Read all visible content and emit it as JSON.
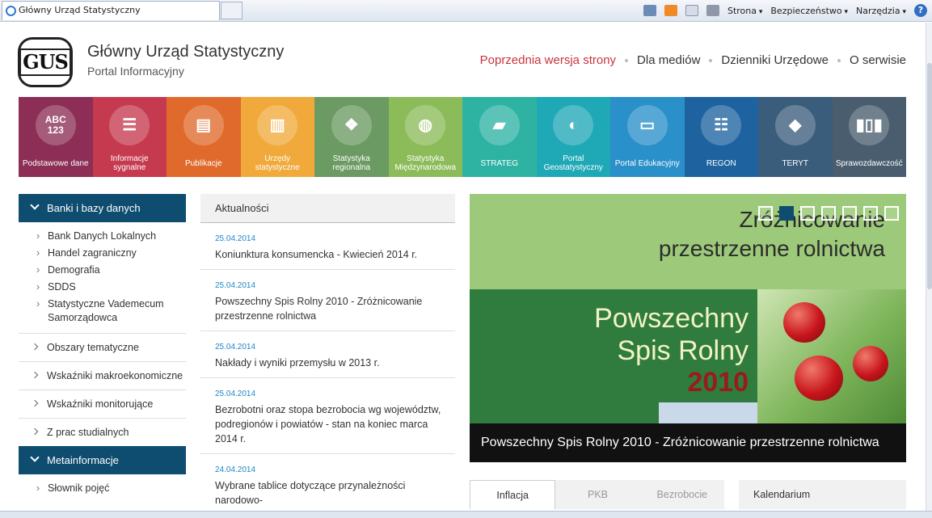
{
  "browser": {
    "tab_title": "Główny Urząd Statystyczny",
    "menu_strona": "Strona",
    "menu_bezpieczenstwo": "Bezpieczeństwo",
    "menu_narzedzia": "Narzędzia",
    "help_label": "?"
  },
  "header": {
    "logo_text": "GUS",
    "title": "Główny Urząd Statystyczny",
    "subtitle": "Portal Informacyjny",
    "nav": [
      "Poprzednia wersja strony",
      "Dla mediów",
      "Dzienniki Urzędowe",
      "O serwisie"
    ]
  },
  "tiles": [
    {
      "label": "Podstawowe dane",
      "icon": "abc-123-icon",
      "color": "#8c2e55",
      "glyph": "ABC\n123"
    },
    {
      "label": "Informacje sygnalne",
      "icon": "speech-bubbles-icon",
      "color": "#c63a4f",
      "glyph": "☰"
    },
    {
      "label": "Publikacje",
      "icon": "calendar-list-icon",
      "color": "#e06a2c",
      "glyph": "▤"
    },
    {
      "label": "Urzędy statystyczne",
      "icon": "buildings-icon",
      "color": "#f0a93a",
      "glyph": "▥"
    },
    {
      "label": "Statystyka regionalna",
      "icon": "regions-map-icon",
      "color": "#6b9a62",
      "glyph": "❖"
    },
    {
      "label": "Statystyka Międzynarodowa",
      "icon": "globe-icon",
      "color": "#8cbc5a",
      "glyph": "◍"
    },
    {
      "label": "STRATEG",
      "icon": "strateg-icon",
      "color": "#2eb3a3",
      "glyph": "▰"
    },
    {
      "label": "Portal Geostatystyczny",
      "icon": "geo-portal-icon",
      "color": "#1fa8b6",
      "glyph": "◐"
    },
    {
      "label": "Portal Edukacyjny",
      "icon": "monitor-cursor-icon",
      "color": "#2a90c9",
      "glyph": "▭"
    },
    {
      "label": "REGON",
      "icon": "document-search-icon",
      "color": "#1e63a0",
      "glyph": "☷"
    },
    {
      "label": "TERYT",
      "icon": "poland-map-icon",
      "color": "#3a5d7c",
      "glyph": "◆"
    },
    {
      "label": "Sprawozdawczość",
      "icon": "bar-chart-icon",
      "color": "#4a5d6e",
      "glyph": "▮▯▮"
    }
  ],
  "sidebar": {
    "section1": "Banki i bazy danych",
    "section1_items": [
      "Bank Danych Lokalnych",
      "Handel zagraniczny",
      "Demografia",
      "SDDS",
      "Statystyczne Vademecum Samorządowca"
    ],
    "categories": [
      "Obszary tematyczne",
      "Wskaźniki makroekonomiczne",
      "Wskaźniki monitorujące",
      "Z prac studialnych"
    ],
    "section2": "Metainformacje",
    "section2_items": [
      "Słownik pojęć"
    ]
  },
  "news": {
    "heading": "Aktualności",
    "items": [
      {
        "date": "25.04.2014",
        "title": "Koniunktura konsumencka - Kwiecień 2014 r."
      },
      {
        "date": "25.04.2014",
        "title": "Powszechny Spis Rolny 2010 - Zróżnicowanie przestrzenne rolnictwa"
      },
      {
        "date": "25.04.2014",
        "title": "Nakłady i wyniki przemysłu w 2013 r."
      },
      {
        "date": "25.04.2014",
        "title": "Bezrobotni oraz stopa bezrobocia wg województw, podregionów i powiatów - stan na koniec marca 2014 r."
      },
      {
        "date": "24.04.2014",
        "title": "Wybrane tablice dotyczące przynależności narodowo-"
      }
    ]
  },
  "slider": {
    "image_title": "Zróżnicowanie przestrzenne rolnictwa",
    "book_line1": "Powszechny",
    "book_line2": "Spis Rolny",
    "book_year": "2010",
    "caption": "Powszechny Spis Rolny 2010 - Zróżnicowanie przestrzenne rolnictwa",
    "active_slide": 2,
    "slide_count": 7
  },
  "bottom_tabs": [
    "Inflacja",
    "PKB",
    "Bezrobocie"
  ],
  "calendar": "Kalendarium"
}
